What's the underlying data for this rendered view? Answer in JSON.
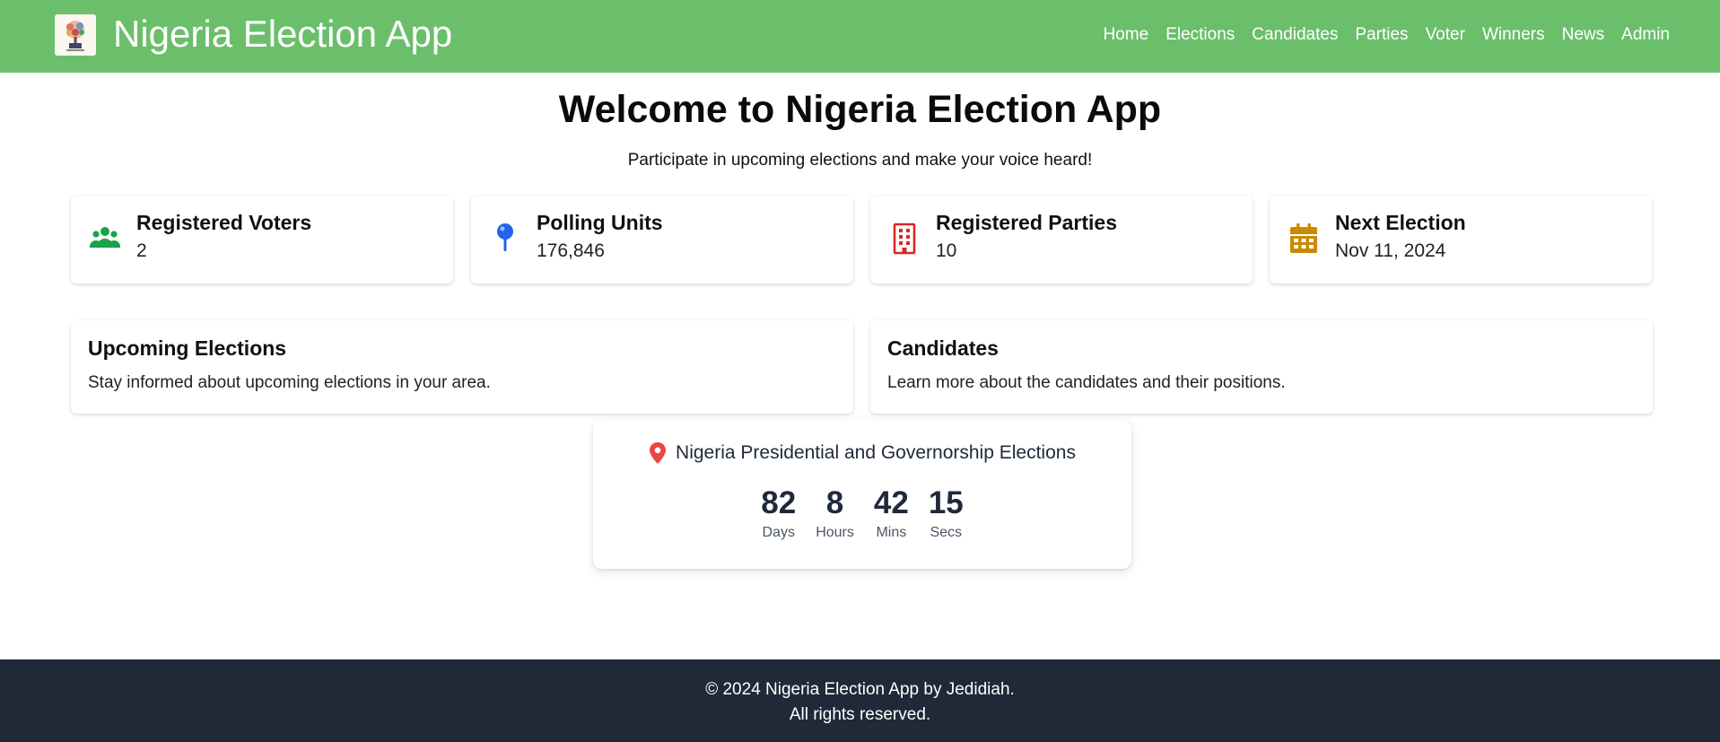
{
  "header": {
    "title": "Nigeria Election App",
    "logo_icon": "ballot-tree-logo",
    "nav": [
      "Home",
      "Elections",
      "Candidates",
      "Parties",
      "Voter",
      "Winners",
      "News",
      "Admin"
    ],
    "background_color": "#6bbf6b"
  },
  "hero": {
    "title": "Welcome to Nigeria Election App",
    "subtitle": "Participate in upcoming elections and make your voice heard!"
  },
  "stats": [
    {
      "label": "Registered Voters",
      "value": "2",
      "icon": "users-icon",
      "color": "#16a34a"
    },
    {
      "label": "Polling Units",
      "value": "176,846",
      "icon": "map-pin-icon",
      "color": "#2563eb"
    },
    {
      "label": "Registered Parties",
      "value": "10",
      "icon": "building-icon",
      "color": "#dc2626"
    },
    {
      "label": "Next Election",
      "value": "Nov 11, 2024",
      "icon": "calendar-icon",
      "color": "#ca8a04"
    }
  ],
  "info_cards": [
    {
      "title": "Upcoming Elections",
      "text": "Stay informed about upcoming elections in your area."
    },
    {
      "title": "Candidates",
      "text": "Learn more about the candidates and their positions."
    }
  ],
  "countdown": {
    "title": "Nigeria Presidential and Governorship Elections",
    "icon": "location-pin-icon",
    "icon_color": "#ef4444",
    "units": [
      {
        "value": "82",
        "label": "Days"
      },
      {
        "value": "8",
        "label": "Hours"
      },
      {
        "value": "42",
        "label": "Mins"
      },
      {
        "value": "15",
        "label": "Secs"
      }
    ]
  },
  "footer": {
    "line1": "© 2024 Nigeria Election App by Jedidiah.",
    "line2": "All rights reserved.",
    "background_color": "#1f2937"
  }
}
